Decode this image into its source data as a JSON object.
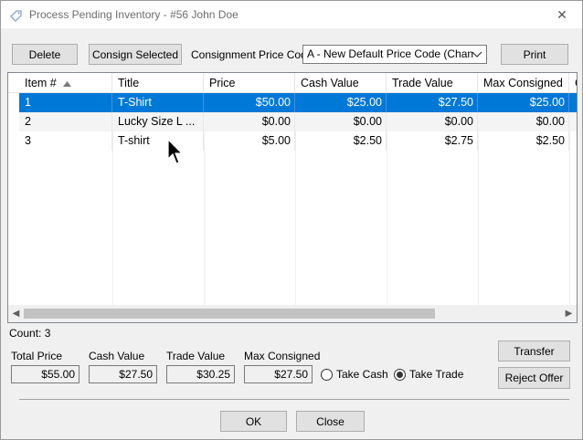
{
  "window": {
    "title": "Process Pending Inventory - #56 John Doe",
    "close_glyph": "✕"
  },
  "toolbar": {
    "delete_label": "Delete",
    "consign_selected_label": "Consign Selected",
    "price_code_label": "Consignment Price Code",
    "price_code_value": "A - New Default Price Code (Changed",
    "print_label": "Print"
  },
  "grid": {
    "columns": [
      {
        "label": "Item #"
      },
      {
        "label": "Title"
      },
      {
        "label": "Price"
      },
      {
        "label": "Cash Value"
      },
      {
        "label": "Trade Value"
      },
      {
        "label": "Max Consigned"
      },
      {
        "label": "C"
      }
    ],
    "sort_column": "Item #",
    "rows": [
      {
        "item": "1",
        "title": "T-Shirt",
        "price": "$50.00",
        "cash": "$25.00",
        "trade": "$27.50",
        "max": "$25.00"
      },
      {
        "item": "2",
        "title": "Lucky Size L ...",
        "price": "$0.00",
        "cash": "$0.00",
        "trade": "$0.00",
        "max": "$0.00"
      },
      {
        "item": "3",
        "title": "T-shirt",
        "price": "$5.00",
        "cash": "$2.50",
        "trade": "$2.75",
        "max": "$2.50"
      }
    ],
    "selected_row": 1
  },
  "summary": {
    "count_label": "Count: 3",
    "total_price_label": "Total Price",
    "total_price_value": "$55.00",
    "cash_value_label": "Cash Value",
    "cash_value_value": "$27.50",
    "trade_value_label": "Trade Value",
    "trade_value_value": "$30.25",
    "max_consigned_label": "Max Consigned",
    "max_consigned_value": "$27.50",
    "take_cash_label": "Take Cash",
    "take_trade_label": "Take Trade",
    "selected_option": "Take Trade"
  },
  "side_buttons": {
    "transfer_label": "Transfer",
    "reject_offer_label": "Reject Offer"
  },
  "footer": {
    "ok_label": "OK",
    "close_label": "Close"
  },
  "colors": {
    "selection": "#0078d7",
    "window_bg": "#f0f0f0"
  }
}
